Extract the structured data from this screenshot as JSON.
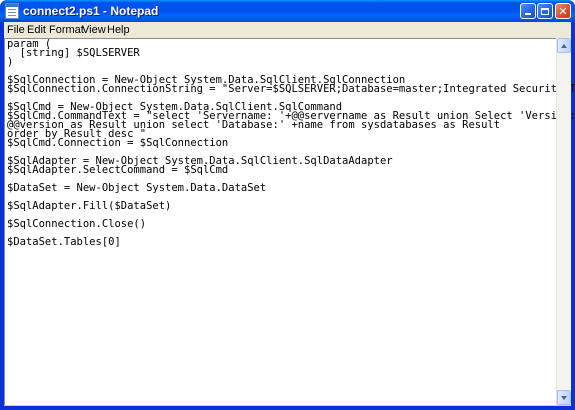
{
  "window": {
    "title": "connect2.ps1 - Notepad",
    "minimize_icon": "minimize-icon",
    "maximize_icon": "maximize-icon",
    "close_icon": "close-icon",
    "close_label": "✕"
  },
  "menu": {
    "items": [
      {
        "label": "File"
      },
      {
        "label": "Edit"
      },
      {
        "label": "Format"
      },
      {
        "label": "View"
      },
      {
        "label": "Help"
      }
    ]
  },
  "editor": {
    "content": "param (\n  [string] $SQLSERVER\n)\n\n$SqlConnection = New-Object System.Data.SqlClient.SqlConnection\n$SqlConnection.ConnectionString = \"Server=$SQLSERVER;Database=master;Integrated Security=True\"\n\n$SqlCmd = New-Object System.Data.SqlClient.SqlCommand\n$SqlCmd.CommandText = \"select 'Servername: '+@@servername as Result union Select 'Version:'+\n@@version as Result union select 'Database:' +name from sysdatabases as Result\norder by Result desc \"\n$SqlCmd.Connection = $SqlConnection\n\n$SqlAdapter = New-Object System.Data.SqlClient.SqlDataAdapter\n$SqlAdapter.SelectCommand = $SqlCmd\n\n$DataSet = New-Object System.Data.DataSet\n\n$SqlAdapter.Fill($DataSet)\n\n$SqlConnection.Close()\n\n$DataSet.Tables[0]"
  },
  "scrollbar": {
    "up_icon": "scroll-up-arrow-icon",
    "down_icon": "scroll-down-arrow-icon"
  }
}
